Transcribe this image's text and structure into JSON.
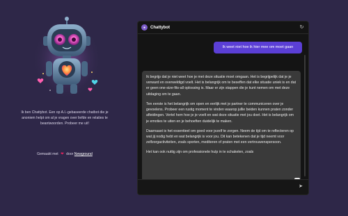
{
  "sidebar": {
    "intro": "Ik ben Chattybot. Een op A.I.-gebaseerde chatbot die je anoniem helpt om al je vragen over liefde en relaties te beantwoorden. Probeer me uit!",
    "credits_prefix": "Gemaakt met",
    "credits_middle": "door",
    "credits_link": "Newground",
    "robot_image": "robot-mascot-with-heart",
    "colors": {
      "heart": "#e0245e"
    }
  },
  "chat": {
    "title": "Chattybot",
    "header_icons": [
      "chattybot-logo-icon",
      "refresh-icon"
    ],
    "user_message": "Ik weet niet hoe ik hier mee om moet gaan",
    "bot_paragraphs": [
      "Ik begrijp dat je niet weet hoe je met deze situatie moet omgaan. Het is begrijpelijk dat je je verward en overweldigd voelt. Het is belangrijk om te beseffen dat elke situatie uniek is en dat er geen one-size-fits-all oplossing is. Maar er zijn stappen die je kunt nemen om met deze uitdaging om te gaan.",
      "Ten eerste is het belangrijk om open en eerlijk met je partner te communiceren over je gevoelens. Probeer een rustig moment te vinden waarop jullie beiden kunnen praten zonder afleidingen. Vertel hem hoe je je voelt en wat deze situatie met jou doet. Het is belangrijk om je emoties te uiten en je behoeften duidelijk te maken.",
      "Daarnaast is het essentieel om goed voor jezelf te zorgen. Neem de tijd om te reflecteren op wat jij nodig hebt en wat belangrijk is voor jou. Dit kan betekenen dat je tijd neemt voor zelfzorgactiviteiten, zoals sporten, mediteren of praten met een vertrouwenspersoon.",
      "Het kan ook nuttig zijn om professionele hulp in te schakelen, zoals"
    ],
    "input_placeholder": "",
    "send_icon": "send-icon",
    "scroll_icon": "arrow-down-icon",
    "colors": {
      "user_bubble": "#5b3fd6",
      "bot_bubble": "#3a3a3a",
      "window_bg": "#141414",
      "page_bg": "#2e2748"
    }
  }
}
